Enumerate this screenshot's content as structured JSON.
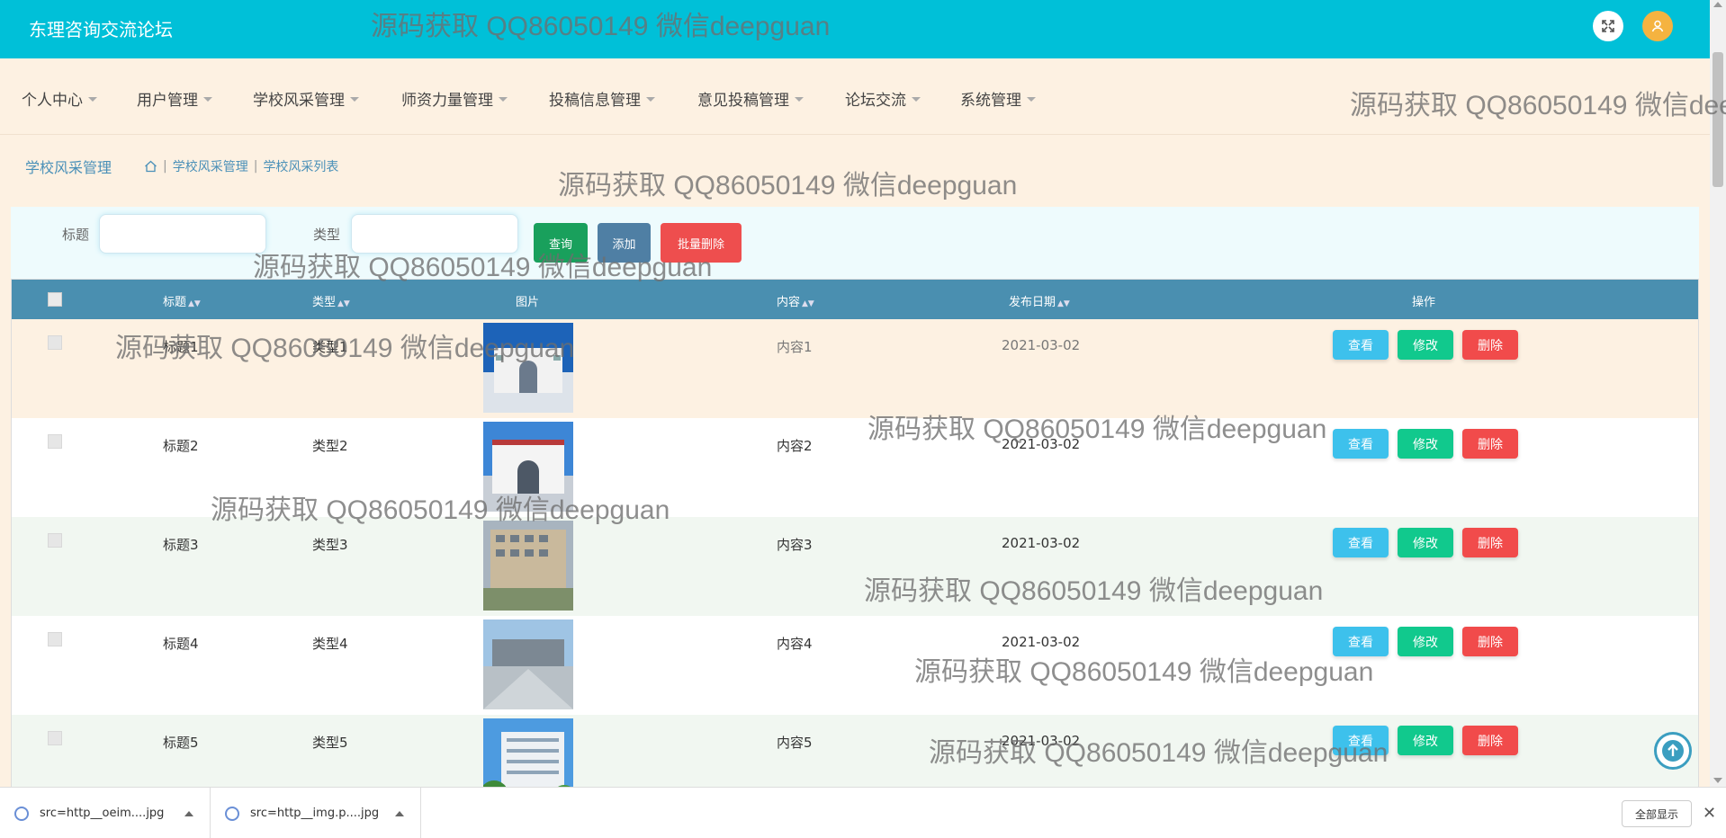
{
  "app": {
    "brand": "东理咨询交流论坛"
  },
  "header": {
    "fullscreen_icon": "fullscreen-icon",
    "avatar_icon": "user-avatar-icon"
  },
  "nav": {
    "items": [
      {
        "label": "个人中心"
      },
      {
        "label": "用户管理"
      },
      {
        "label": "学校风采管理"
      },
      {
        "label": "师资力量管理"
      },
      {
        "label": "投稿信息管理"
      },
      {
        "label": "意见投稿管理"
      },
      {
        "label": "论坛交流"
      },
      {
        "label": "系统管理"
      }
    ]
  },
  "breadcrumb": {
    "title": "学校风采管理",
    "home_icon": "home-icon",
    "path": [
      "学校风采管理",
      "学校风采列表"
    ]
  },
  "search": {
    "title_label": "标题",
    "title_value": "",
    "type_label": "类型",
    "type_value": "",
    "query_button": "查询",
    "add_button": "添加",
    "bulk_delete_button": "批量删除"
  },
  "table": {
    "columns": [
      "标题",
      "类型",
      "图片",
      "内容",
      "发布日期",
      "操作"
    ],
    "rows": [
      {
        "title": "标题1",
        "type": "类型1",
        "content": "内容1",
        "date": "2021-03-02"
      },
      {
        "title": "标题2",
        "type": "类型2",
        "content": "内容2",
        "date": "2021-03-02"
      },
      {
        "title": "标题3",
        "type": "类型3",
        "content": "内容3",
        "date": "2021-03-02"
      },
      {
        "title": "标题4",
        "type": "类型4",
        "content": "内容4",
        "date": "2021-03-02"
      },
      {
        "title": "标题5",
        "type": "类型5",
        "content": "内容5",
        "date": "2021-03-02"
      }
    ],
    "actions": {
      "view": "查看",
      "edit": "修改",
      "delete": "删除"
    }
  },
  "downloads": {
    "items": [
      {
        "name": "src=http__oeim....jpg"
      },
      {
        "name": "src=http__img.p....jpg"
      }
    ],
    "show_all": "全部显示"
  },
  "watermark": "源码获取 QQ86050149 微信deepguan",
  "colors": {
    "header": "#00c0d8",
    "table_header": "#4a8fb0",
    "view": "#3dc1ec",
    "edit": "#11c98d",
    "delete": "#f14b4b"
  }
}
